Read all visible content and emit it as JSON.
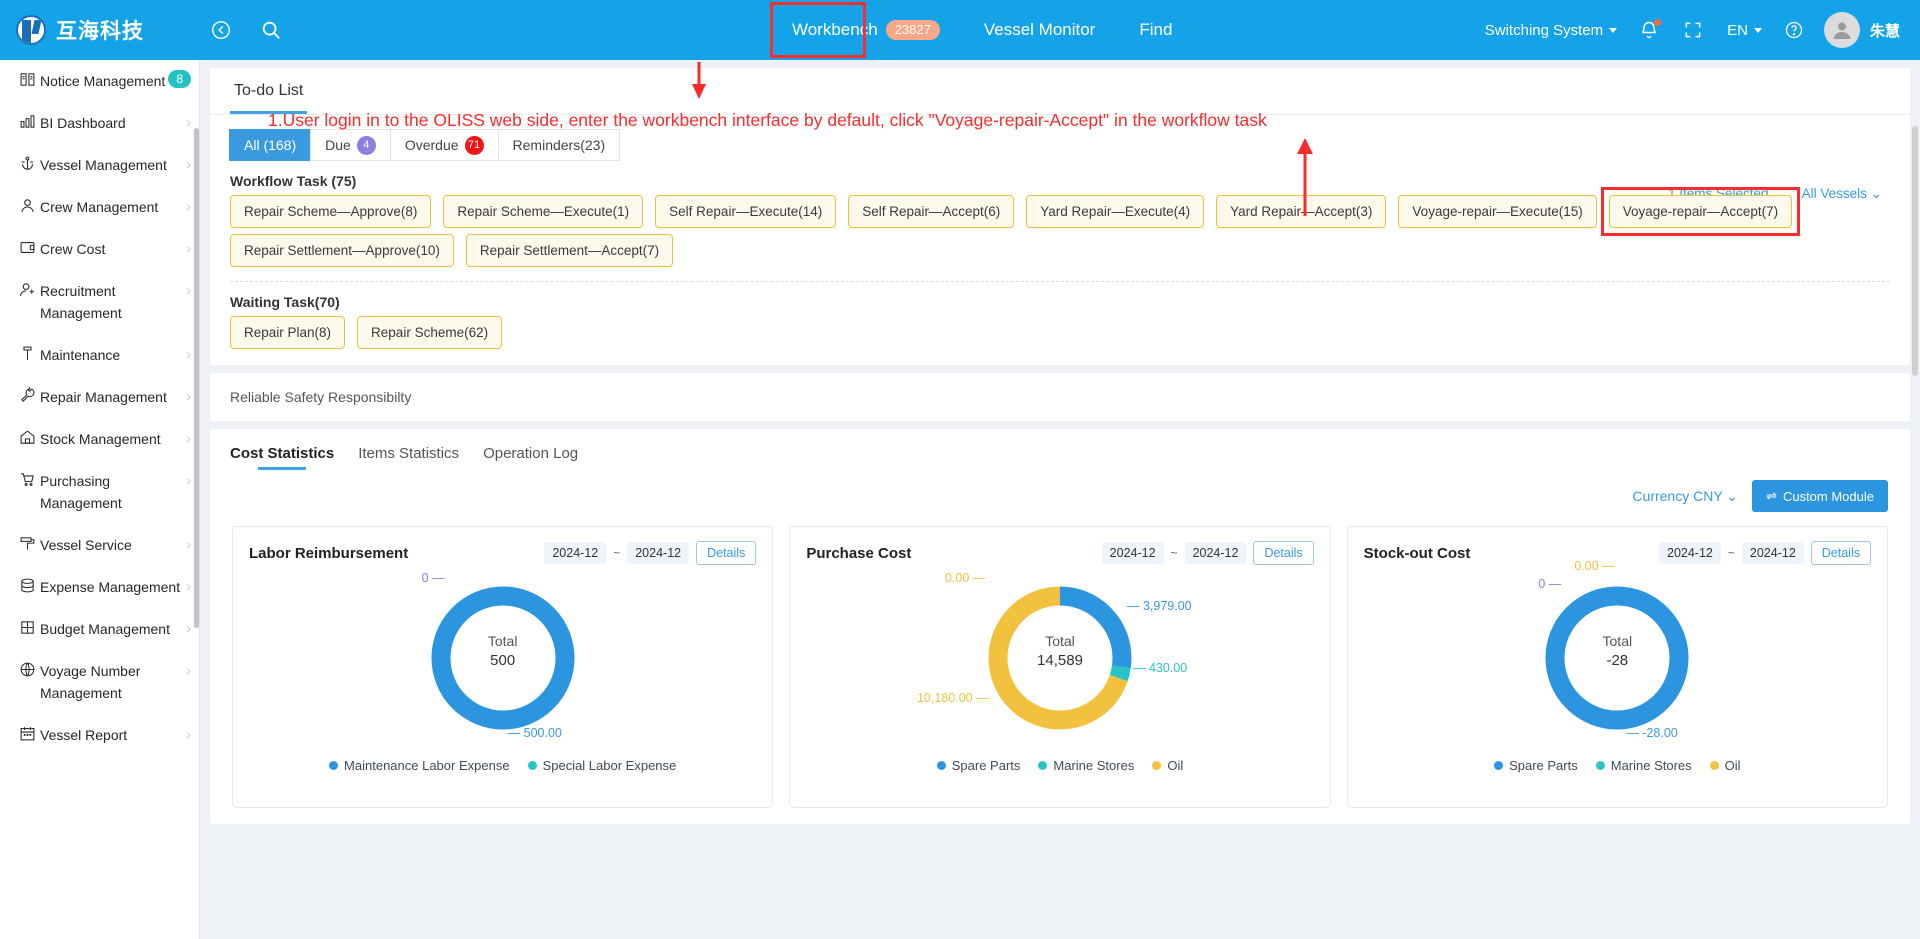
{
  "topbar": {
    "brand_name": "互海科技",
    "collapse_icon": "collapse-left-icon",
    "search_icon": "search-icon",
    "nav": [
      {
        "label": "Workbench",
        "badge": "23827",
        "active": true
      },
      {
        "label": "Vessel Monitor",
        "badge": "",
        "active": false
      },
      {
        "label": "Find",
        "badge": "",
        "active": false
      }
    ],
    "switching_system": "Switching System",
    "bell_icon": "bell-icon",
    "expand_icon": "fullscreen-icon",
    "language": "EN",
    "help_icon": "question-circle-icon",
    "user_name": "朱慧"
  },
  "sidebar": {
    "items": [
      {
        "label": "Notice Management",
        "icon": "book-icon",
        "badge": "8",
        "arrow": false
      },
      {
        "label": "BI Dashboard",
        "icon": "bar-chart-icon",
        "badge": "",
        "arrow": true
      },
      {
        "label": "Vessel Management",
        "icon": "anchor-icon",
        "badge": "",
        "arrow": true
      },
      {
        "label": "Crew Management",
        "icon": "user-icon",
        "badge": "",
        "arrow": true
      },
      {
        "label": "Crew Cost",
        "icon": "wallet-icon",
        "badge": "",
        "arrow": true
      },
      {
        "label": "Recruitment Management",
        "icon": "user-plus-icon",
        "badge": "",
        "arrow": true
      },
      {
        "label": "Maintenance",
        "icon": "hammer-icon",
        "badge": "",
        "arrow": true
      },
      {
        "label": "Repair Management",
        "icon": "wrench-icon",
        "badge": "",
        "arrow": true
      },
      {
        "label": "Stock Management",
        "icon": "warehouse-icon",
        "badge": "",
        "arrow": true
      },
      {
        "label": "Purchasing Management",
        "icon": "cart-icon",
        "badge": "",
        "arrow": true
      },
      {
        "label": "Vessel Service",
        "icon": "roller-icon",
        "badge": "",
        "arrow": true
      },
      {
        "label": "Expense Management",
        "icon": "database-icon",
        "badge": "",
        "arrow": true
      },
      {
        "label": "Budget Management",
        "icon": "table-icon",
        "badge": "",
        "arrow": true
      },
      {
        "label": "Voyage Number Management",
        "icon": "globe-icon",
        "badge": "",
        "arrow": true
      },
      {
        "label": "Vessel Report",
        "icon": "calendar-icon",
        "badge": "",
        "arrow": true
      }
    ]
  },
  "todo": {
    "tab_label": "To-do List",
    "filters": [
      {
        "label": "All (168)",
        "badge": "",
        "badge_color": "",
        "active": true
      },
      {
        "label": "Due",
        "badge": "4",
        "badge_color": "purple",
        "active": false
      },
      {
        "label": "Overdue",
        "badge": "71",
        "badge_color": "red",
        "active": false
      },
      {
        "label": "Reminders(23)",
        "badge": "",
        "badge_color": "",
        "active": false
      }
    ],
    "items_selected": "1 Items Selected",
    "all_vessels": "All Vessels",
    "workflow_title": "Workflow Task (75)",
    "workflow_tags": [
      {
        "label": "Repair Scheme—Approve(8)",
        "highlight": false
      },
      {
        "label": "Repair Scheme—Execute(1)",
        "highlight": false
      },
      {
        "label": "Self Repair—Execute(14)",
        "highlight": false
      },
      {
        "label": "Self Repair—Accept(6)",
        "highlight": false
      },
      {
        "label": "Yard Repair—Execute(4)",
        "highlight": false
      },
      {
        "label": "Yard Repair—Accept(3)",
        "highlight": false
      },
      {
        "label": "Voyage-repair—Execute(15)",
        "highlight": false
      },
      {
        "label": "Voyage-repair—Accept(7)",
        "highlight": true
      },
      {
        "label": "Repair Settlement—Approve(10)",
        "highlight": false
      },
      {
        "label": "Repair Settlement—Accept(7)",
        "highlight": false
      }
    ],
    "waiting_title": "Waiting Task(70)",
    "waiting_tags": [
      {
        "label": "Repair Plan(8)"
      },
      {
        "label": "Repair Scheme(62)"
      }
    ],
    "reliable_safety": "Reliable Safety Responsibilty"
  },
  "statistics": {
    "tabs": [
      {
        "label": "Cost Statistics",
        "active": true
      },
      {
        "label": "Items Statistics",
        "active": false
      },
      {
        "label": "Operation Log",
        "active": false
      }
    ],
    "currency": "Currency CNY",
    "custom_module": "Custom Module",
    "custom_module_icon": "settings-sliders-icon"
  },
  "annotation": {
    "text": "1.User login in to the OLISS web side, enter the workbench interface by default, click \"Voyage-repair-Accept\" in the workflow task",
    "color": "#fc2b2b"
  },
  "chart_data": [
    {
      "type": "pie",
      "title": "Labor Reimbursement",
      "date_from": "2024-12",
      "date_to": "2024-12",
      "details_label": "Details",
      "total_label": "Total",
      "total_value": "500",
      "categories": [
        "Maintenance Labor Expense",
        "Special Labor Expense"
      ],
      "values": [
        500.0,
        0
      ],
      "value_labels": [
        "500.00",
        "0"
      ],
      "colors": [
        "#2b95e0",
        "#2bc4c4"
      ],
      "legend_position": "bottom"
    },
    {
      "type": "pie",
      "title": "Purchase Cost",
      "date_from": "2024-12",
      "date_to": "2024-12",
      "details_label": "Details",
      "total_label": "Total",
      "total_value": "14,589",
      "categories": [
        "Spare Parts",
        "Marine Stores",
        "Oil"
      ],
      "values": [
        3979.0,
        430.0,
        10180.0
      ],
      "value_labels": [
        "3,979.00",
        "430.00",
        "10,180.00",
        "0.00"
      ],
      "colors": [
        "#2b95e0",
        "#2bc4c4",
        "#f2c23e"
      ],
      "legend_position": "bottom"
    },
    {
      "type": "pie",
      "title": "Stock-out Cost",
      "date_from": "2024-12",
      "date_to": "2024-12",
      "details_label": "Details",
      "total_label": "Total",
      "total_value": "-28",
      "categories": [
        "Spare Parts",
        "Marine Stores",
        "Oil"
      ],
      "values": [
        -28.0,
        0,
        0.0
      ],
      "value_labels": [
        "-28.00",
        "0",
        "0.00"
      ],
      "colors": [
        "#2b95e0",
        "#2bc4c4",
        "#f2c23e"
      ],
      "legend_position": "bottom"
    }
  ]
}
